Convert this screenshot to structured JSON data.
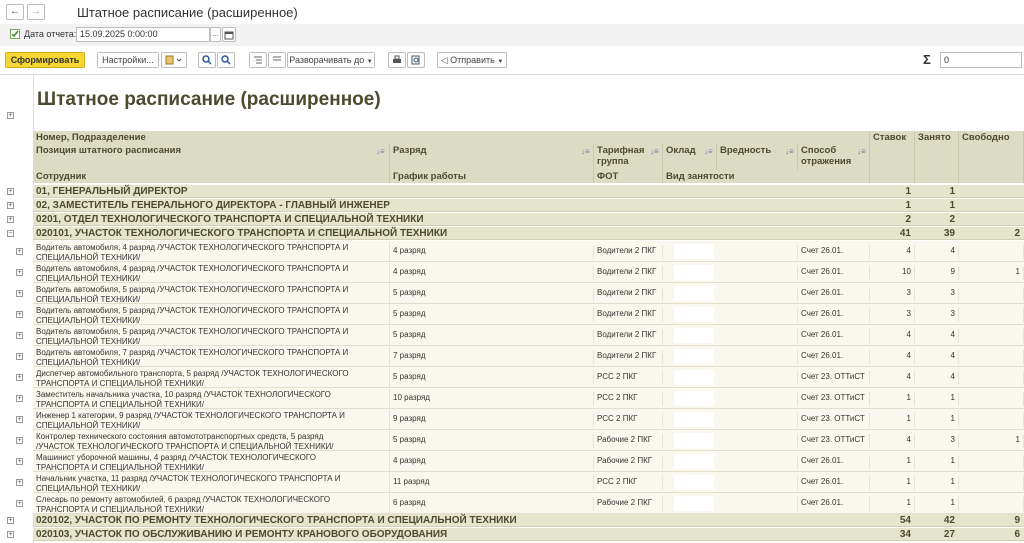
{
  "window": {
    "back": "←",
    "forward": "→",
    "title": "Штатное расписание (расширенное)"
  },
  "params": {
    "date_label": "Дата отчета:",
    "date_value": "15.09.2025  0:00:00"
  },
  "toolbar": {
    "generate": "Сформировать",
    "settings": "Настройки...",
    "expand": "Разворачивать до",
    "send": "Отправить",
    "sum_symbol": "Σ",
    "sum_value": "0"
  },
  "report": {
    "title": "Штатное расписание (расширенное)",
    "headers": {
      "dept": "Номер, Подразделение",
      "position": "Позиция штатного расписания",
      "employee": "Сотрудник",
      "grade": "Разряд",
      "schedule": "График работы",
      "tariff": "Тарифная группа",
      "fot": "ФОТ",
      "salary": "Оклад",
      "employment": "Вид занятости",
      "harm": "Вредность",
      "method": "Способ отражения",
      "rates": "Ставок",
      "taken": "Занято",
      "free": "Свободно"
    },
    "groups_top": [
      {
        "name": "01, ГЕНЕРАЛЬНЫЙ ДИРЕКТОР",
        "rates": "1",
        "taken": "1",
        "free": ""
      },
      {
        "name": "02, ЗАМЕСТИТЕЛЬ ГЕНЕРАЛЬНОГО ДИРЕКТОРА - ГЛАВНЫЙ ИНЖЕНЕР",
        "rates": "1",
        "taken": "1",
        "free": ""
      },
      {
        "name": "0201, ОТДЕЛ ТЕХНОЛОГИЧЕСКОГО ТРАНСПОРТА И СПЕЦИАЛЬНОЙ ТЕХНИКИ",
        "rates": "2",
        "taken": "2",
        "free": ""
      },
      {
        "name": "020101, УЧАСТОК ТЕХНОЛОГИЧЕСКОГО ТРАНСПОРТА И СПЕЦИАЛЬНОЙ ТЕХНИКИ",
        "rates": "41",
        "taken": "39",
        "free": "2"
      }
    ],
    "rows": [
      {
        "pos1": "Водитель автомобиля, 4 разряд /УЧАСТОК ТЕХНОЛОГИЧЕСКОГО ТРАНСПОРТА И",
        "pos2": "СПЕЦИАЛЬНОЙ ТЕХНИКИ/",
        "grade": "4 разряд",
        "tariff": "Водители 2 ПКГ",
        "method": "Счет 26.01.",
        "rates": "4",
        "taken": "4",
        "free": ""
      },
      {
        "pos1": "Водитель автомобиля, 4 разряд /УЧАСТОК ТЕХНОЛОГИЧЕСКОГО ТРАНСПОРТА И",
        "pos2": "СПЕЦИАЛЬНОЙ ТЕХНИКИ/",
        "grade": "4 разряд",
        "tariff": "Водители 2 ПКГ",
        "method": "Счет 26.01.",
        "rates": "10",
        "taken": "9",
        "free": "1"
      },
      {
        "pos1": "Водитель автомобиля, 5 разряд /УЧАСТОК ТЕХНОЛОГИЧЕСКОГО ТРАНСПОРТА И",
        "pos2": "СПЕЦИАЛЬНОЙ ТЕХНИКИ/",
        "grade": "5 разряд",
        "tariff": "Водители 2 ПКГ",
        "method": "Счет 26.01.",
        "rates": "3",
        "taken": "3",
        "free": ""
      },
      {
        "pos1": "Водитель автомобиля, 5 разряд /УЧАСТОК ТЕХНОЛОГИЧЕСКОГО ТРАНСПОРТА И",
        "pos2": "СПЕЦИАЛЬНОЙ ТЕХНИКИ/",
        "grade": "5 разряд",
        "tariff": "Водители 2 ПКГ",
        "method": "Счет 26.01.",
        "rates": "3",
        "taken": "3",
        "free": ""
      },
      {
        "pos1": "Водитель автомобиля, 5 разряд /УЧАСТОК ТЕХНОЛОГИЧЕСКОГО ТРАНСПОРТА И",
        "pos2": "СПЕЦИАЛЬНОЙ ТЕХНИКИ/",
        "grade": "5 разряд",
        "tariff": "Водители 2 ПКГ",
        "method": "Счет 26.01.",
        "rates": "4",
        "taken": "4",
        "free": ""
      },
      {
        "pos1": "Водитель автомобиля, 7 разряд /УЧАСТОК ТЕХНОЛОГИЧЕСКОГО ТРАНСПОРТА И",
        "pos2": "СПЕЦИАЛЬНОЙ ТЕХНИКИ/",
        "grade": "7 разряд",
        "tariff": "Водители 2 ПКГ",
        "method": "Счет 26.01.",
        "rates": "4",
        "taken": "4",
        "free": ""
      },
      {
        "pos1": "Диспетчер автомобильного транспорта, 5 разряд /УЧАСТОК ТЕХНОЛОГИЧЕСКОГО",
        "pos2": "ТРАНСПОРТА И СПЕЦИАЛЬНОЙ ТЕХНИКИ/",
        "grade": "5 разряд",
        "tariff": "РСС 2 ПКГ",
        "method": "Счет 23. ОТТиСТ",
        "rates": "4",
        "taken": "4",
        "free": ""
      },
      {
        "pos1": "Заместитель начальника участка, 10 разряд /УЧАСТОК ТЕХНОЛОГИЧЕСКОГО",
        "pos2": "ТРАНСПОРТА И СПЕЦИАЛЬНОЙ ТЕХНИКИ/",
        "grade": "10 разряд",
        "tariff": "РСС 2 ПКГ",
        "method": "Счет 23. ОТТиСТ",
        "rates": "1",
        "taken": "1",
        "free": ""
      },
      {
        "pos1": "Инженер 1 категории, 9 разряд /УЧАСТОК ТЕХНОЛОГИЧЕСКОГО ТРАНСПОРТА И",
        "pos2": "СПЕЦИАЛЬНОЙ ТЕХНИКИ/",
        "grade": "9 разряд",
        "tariff": "РСС 2 ПКГ",
        "method": "Счет 23. ОТТиСТ",
        "rates": "1",
        "taken": "1",
        "free": ""
      },
      {
        "pos1": "Контролер технического состояния автомототранспортных средств, 5 разряд",
        "pos2": "/УЧАСТОК ТЕХНОЛОГИЧЕСКОГО ТРАНСПОРТА И СПЕЦИАЛЬНОЙ ТЕХНИКИ/",
        "grade": "5 разряд",
        "tariff": "Рабочие 2 ПКГ",
        "method": "Счет 23. ОТТиСТ",
        "rates": "4",
        "taken": "3",
        "free": "1"
      },
      {
        "pos1": "Машинист уборочной машины, 4 разряд /УЧАСТОК ТЕХНОЛОГИЧЕСКОГО",
        "pos2": "ТРАНСПОРТА И СПЕЦИАЛЬНОЙ ТЕХНИКИ/",
        "grade": "4 разряд",
        "tariff": "Рабочие 2 ПКГ",
        "method": "Счет 26.01.",
        "rates": "1",
        "taken": "1",
        "free": ""
      },
      {
        "pos1": "Начальник участка, 11 разряд /УЧАСТОК ТЕХНОЛОГИЧЕСКОГО ТРАНСПОРТА И",
        "pos2": "СПЕЦИАЛЬНОЙ ТЕХНИКИ/",
        "grade": "11 разряд",
        "tariff": "РСС 2 ПКГ",
        "method": "Счет 26.01.",
        "rates": "1",
        "taken": "1",
        "free": ""
      },
      {
        "pos1": "Слесарь по ремонту автомобилей, 6 разряд /УЧАСТОК ТЕХНОЛОГИЧЕСКОГО",
        "pos2": "ТРАНСПОРТА И СПЕЦИАЛЬНОЙ ТЕХНИКИ/",
        "grade": "6 разряд",
        "tariff": "Рабочие 2 ПКГ",
        "method": "Счет 26.01.",
        "rates": "1",
        "taken": "1",
        "free": ""
      }
    ],
    "groups_bottom": [
      {
        "name": "020102, УЧАСТОК ПО РЕМОНТУ ТЕХНОЛОГИЧЕСКОГО ТРАНСПОРТА И СПЕЦИАЛЬНОЙ ТЕХНИКИ",
        "rates": "54",
        "taken": "42",
        "free": "9"
      },
      {
        "name": "020103, УЧАСТОК ПО ОБСЛУЖИВАНИЮ И РЕМОНТУ КРАНОВОГО ОБОРУДОВАНИЯ",
        "rates": "34",
        "taken": "27",
        "free": "6"
      }
    ]
  },
  "icons": {
    "checkbox": "checkbox-checked-icon",
    "calendar": "calendar-icon",
    "search": "search-icon",
    "print": "printer-icon"
  },
  "colors": {
    "header_bg": "#dcdcc4",
    "group_bg": "#e5e5cd",
    "row_bg": "#faf8ee",
    "generate_btn": "#f5d632"
  }
}
